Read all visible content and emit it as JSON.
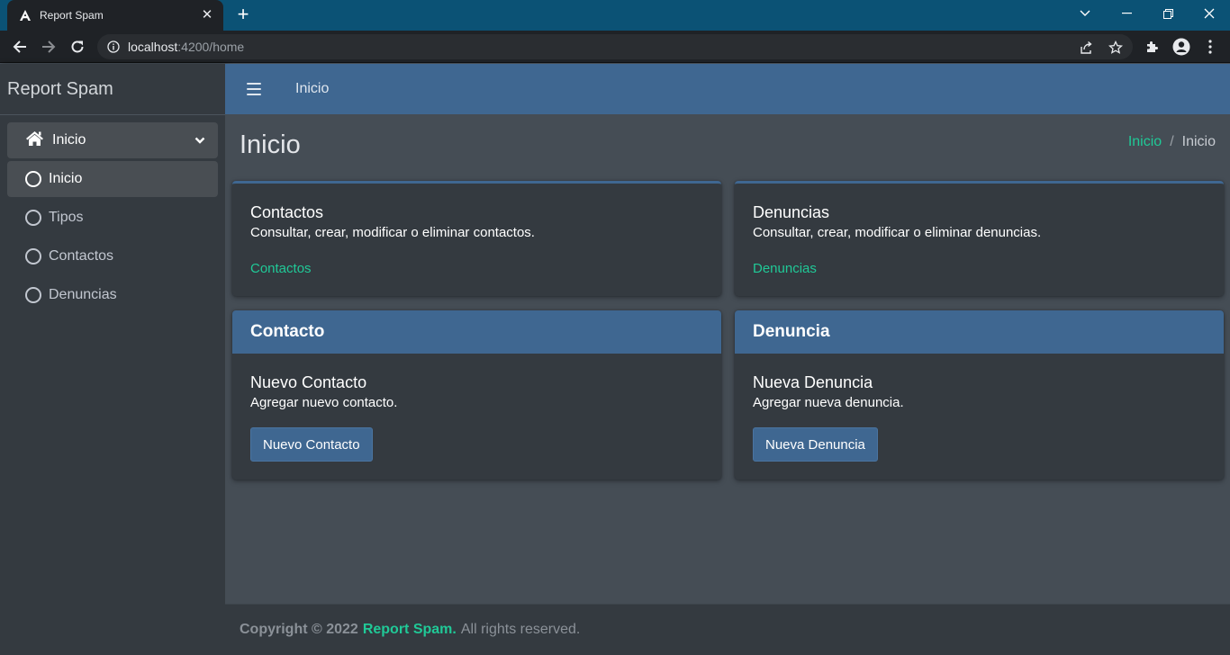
{
  "browser": {
    "tab_title": "Report Spam",
    "url_host": "localhost",
    "url_rest": ":4200/home"
  },
  "sidebar": {
    "brand": "Report Spam",
    "parent_label": "Inicio",
    "items": [
      {
        "label": "Inicio",
        "active": true
      },
      {
        "label": "Tipos",
        "active": false
      },
      {
        "label": "Contactos",
        "active": false
      },
      {
        "label": "Denuncias",
        "active": false
      }
    ]
  },
  "header": {
    "nav_link": "Inicio"
  },
  "page": {
    "title": "Inicio",
    "breadcrumb": {
      "link": "Inicio",
      "separator": "/",
      "current": "Inicio"
    }
  },
  "cards": {
    "contactos": {
      "title": "Contactos",
      "text": "Consultar, crear, modificar o eliminar contactos.",
      "link": "Contactos"
    },
    "denuncias": {
      "title": "Denuncias",
      "text": "Consultar, crear, modificar o eliminar denuncias.",
      "link": "Denuncias"
    },
    "contacto": {
      "header": "Contacto",
      "title": "Nuevo Contacto",
      "text": "Agregar nuevo contacto.",
      "button": "Nuevo Contacto"
    },
    "denuncia": {
      "header": "Denuncia",
      "title": "Nueva Denuncia",
      "text": "Agregar nueva denuncia.",
      "button": "Nueva Denuncia"
    }
  },
  "footer": {
    "copyright": "Copyright © 2022",
    "brand": "Report Spam.",
    "rest": "All rights reserved."
  },
  "colors": {
    "accent": "#20c997",
    "primary": "#3f6791",
    "sidebar_bg": "#343a40",
    "content_bg": "#454d55"
  }
}
